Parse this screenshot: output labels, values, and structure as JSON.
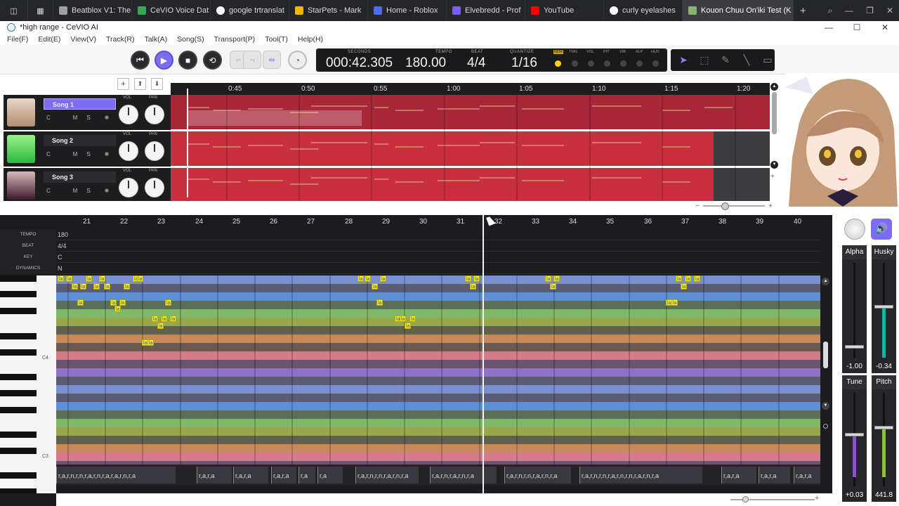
{
  "browser_tabs": [
    {
      "label": "Beatblox V1: The",
      "icon_color": "#9aa0a6"
    },
    {
      "label": "CeVIO Voice Dat",
      "icon_color": "#34a853"
    },
    {
      "label": "google trtranslat",
      "icon_color": "#ffffff"
    },
    {
      "label": "StarPets - Mark",
      "icon_color": "#f4b400"
    },
    {
      "label": "Home - Roblox",
      "icon_color": "#4a6cf7"
    },
    {
      "label": "Elvebredd - Prof",
      "icon_color": "#7b5cff"
    },
    {
      "label": "YouTube",
      "icon_color": "#ff0000"
    },
    {
      "label": "curly eyelashes",
      "icon_color": "#ffffff"
    },
    {
      "label": "Kouon Chuu On'iki Test (K",
      "icon_color": "#8ab46e"
    }
  ],
  "window": {
    "title": "*high range - CeVIO AI"
  },
  "menu": [
    "File(F)",
    "Edit(E)",
    "View(V)",
    "Track(R)",
    "Talk(A)",
    "Song(S)",
    "Transport(P)",
    "Tool(T)",
    "Help(H)"
  ],
  "transport": {
    "seconds_label": "SECONDS",
    "seconds": "000:42.305",
    "tempo_label": "TEMPO",
    "tempo": "180.00",
    "beat_label": "BEAT",
    "beat": "4/4",
    "quantize_label": "QUANTIZE",
    "quantize": "1/16",
    "params": [
      "NOR",
      "TMG",
      "VOL",
      "PIT",
      "VIB",
      "ALP",
      "HUS"
    ]
  },
  "tracks": [
    {
      "name": "Song 1",
      "selected": true,
      "avatar_color": "#c9a78c"
    },
    {
      "name": "Song 2",
      "selected": false,
      "avatar_color": "#4fcf5a"
    },
    {
      "name": "Song 3",
      "selected": false,
      "avatar_color": "#4a2a3a"
    }
  ],
  "track_buttons": {
    "c": "C",
    "m": "M",
    "s": "S",
    "fx": "❋"
  },
  "knob_labels": {
    "vol": "VOL",
    "pan": "PAN"
  },
  "timeline": [
    "0:45",
    "0:50",
    "0:55",
    "1:00",
    "1:05",
    "1:10",
    "1:15",
    "1:20"
  ],
  "measures": [
    "21",
    "22",
    "23",
    "24",
    "25",
    "26",
    "27",
    "28",
    "29",
    "30",
    "31",
    "32",
    "33",
    "34",
    "35",
    "36",
    "37",
    "38",
    "39",
    "40"
  ],
  "params": [
    {
      "label": "TEMPO",
      "value": "180"
    },
    {
      "label": "BEAT",
      "value": "4/4"
    },
    {
      "label": "KEY",
      "value": "C"
    },
    {
      "label": "DYNAMICS",
      "value": "N"
    }
  ],
  "key_labels": [
    {
      "label": "C4"
    },
    {
      "label": "C3"
    }
  ],
  "note_lyric": "la",
  "lyric_blocks": [
    "r,a,r,n,r,n,r,a,r,n,r,a,r,a,r,n,r,a",
    "r,a,r,a",
    "r,a,r,a",
    "r,a,r,a",
    "r,a",
    "r,a",
    "r,a,r,n,r,n,r,a,r,n,r,a",
    "r,a,r,n,r,a,r,n,r,a",
    "r,a,r,n,r,n,r,a,r,n,r,a",
    "r,a,r,n,r,n,r,a,r,n,r,n,r,a,r,n,r,a",
    "r,a,r,a",
    "r,a,r,a",
    "r,a,r,a"
  ],
  "mixer": {
    "alpha": {
      "label": "Alpha",
      "value": "-1.00"
    },
    "husky": {
      "label": "Husky",
      "value": "-0.34"
    },
    "tune": {
      "label": "Tune",
      "value": "+0.03"
    },
    "pitch": {
      "label": "Pitch",
      "value": "441.8"
    }
  }
}
